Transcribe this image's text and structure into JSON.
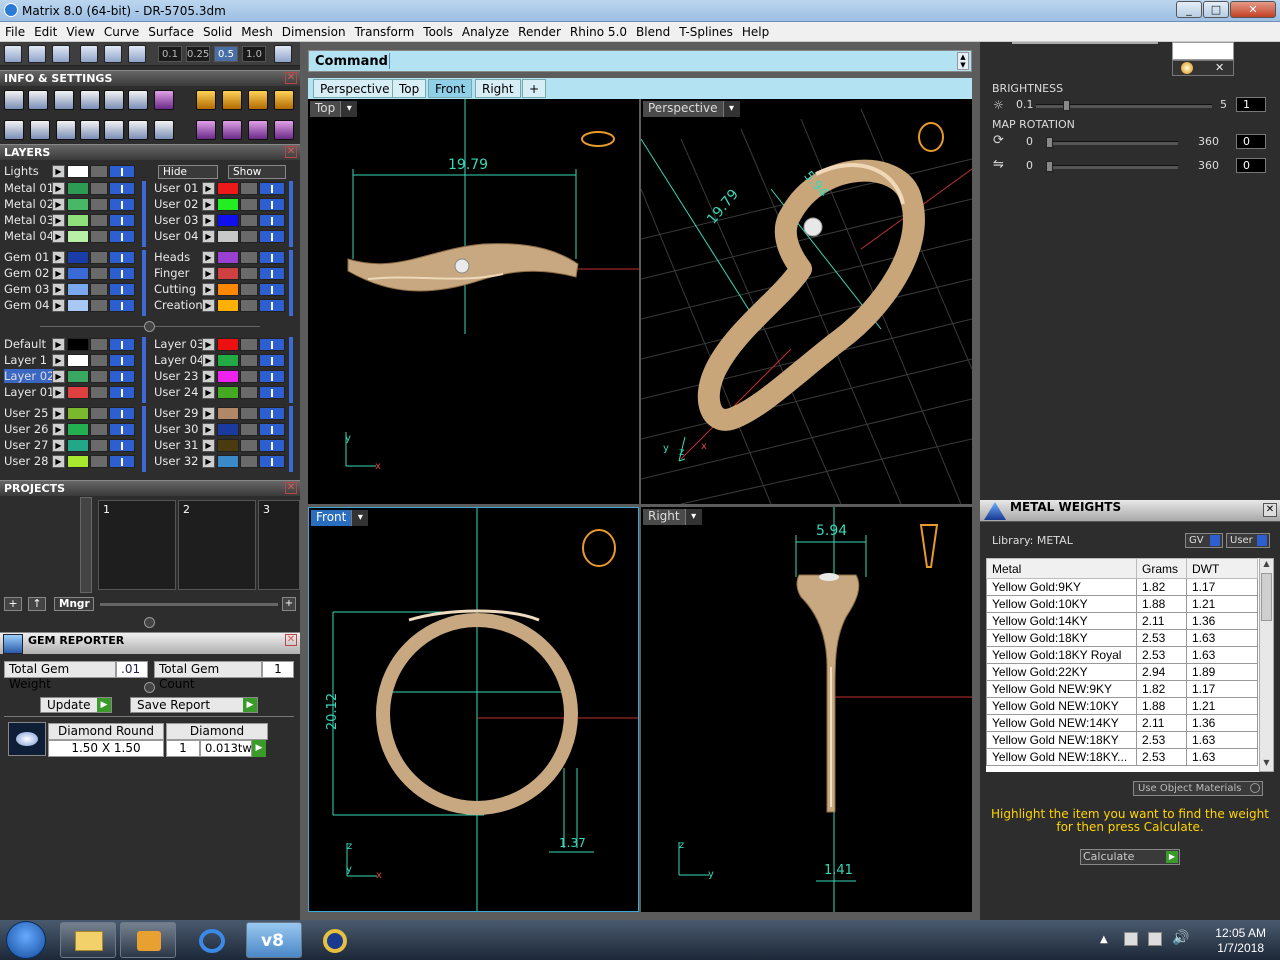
{
  "window": {
    "title": "Matrix 8.0 (64-bit) - DR-5705.3dm",
    "min": "_",
    "max": "□",
    "close": "✕"
  },
  "menu": [
    "File",
    "Edit",
    "View",
    "Curve",
    "Surface",
    "Solid",
    "Mesh",
    "Dimension",
    "Transform",
    "Tools",
    "Analyze",
    "Render",
    "Rhino 5.0",
    "Blend",
    "T-Splines",
    "Help"
  ],
  "toolbar": {
    "num_buttons": [
      "0.1",
      "0.25",
      "0.5",
      "1.0"
    ],
    "active_num": "0.5"
  },
  "panels": {
    "info_settings": "INFO & SETTINGS",
    "layers": "LAYERS",
    "projects": "PROJECTS",
    "gem_reporter": "GEM REPORTER",
    "close_glyph": "✕"
  },
  "layers": {
    "lights": "Lights",
    "hide": "Hide",
    "show": "Show",
    "left": [
      {
        "name": "Metal 01",
        "color": "#2e9b54"
      },
      {
        "name": "Metal 02",
        "color": "#46b866"
      },
      {
        "name": "Metal 03",
        "color": "#8ee07a"
      },
      {
        "name": "Metal 04",
        "color": "#b8f0a8"
      },
      {
        "name": "Gem 01",
        "color": "#1a3ea8"
      },
      {
        "name": "Gem 02",
        "color": "#3a6ad6"
      },
      {
        "name": "Gem 03",
        "color": "#7aa8ee"
      },
      {
        "name": "Gem 04",
        "color": "#a8c8f6"
      },
      {
        "name": "Default",
        "color": "#000000"
      },
      {
        "name": "Layer 1",
        "color": "#ffffff"
      },
      {
        "name": "Layer 02",
        "color": "#3aa860"
      },
      {
        "name": "Layer 01",
        "color": "#e04040"
      },
      {
        "name": "User 25",
        "color": "#7ab82e"
      },
      {
        "name": "User 26",
        "color": "#22b050"
      },
      {
        "name": "User 27",
        "color": "#22a888"
      },
      {
        "name": "User 28",
        "color": "#a8e82e"
      }
    ],
    "right": [
      {
        "name": "User 01",
        "color": "#ee1a1a"
      },
      {
        "name": "User 02",
        "color": "#22ee22"
      },
      {
        "name": "User 03",
        "color": "#1010ee"
      },
      {
        "name": "User 04",
        "color": "#c8c8c8"
      },
      {
        "name": "Heads",
        "color": "#9a40d0"
      },
      {
        "name": "Finger",
        "color": "#d04040"
      },
      {
        "name": "Cutting",
        "color": "#ff8800"
      },
      {
        "name": "Creation",
        "color": "#ffb000"
      },
      {
        "name": "Layer 03",
        "color": "#ee1010"
      },
      {
        "name": "Layer 04",
        "color": "#22aa44"
      },
      {
        "name": "User 23",
        "color": "#ee22ee"
      },
      {
        "name": "User 24",
        "color": "#44aa22"
      },
      {
        "name": "User 29",
        "color": "#b08868"
      },
      {
        "name": "User 30",
        "color": "#1a3aa0"
      },
      {
        "name": "User 31",
        "color": "#4a3a10"
      },
      {
        "name": "User 32",
        "color": "#3a8ac8"
      }
    ],
    "selected": "Layer 02"
  },
  "projects": {
    "slots": [
      "1",
      "2",
      "3"
    ],
    "mngr": "Mngr"
  },
  "gem_reporter": {
    "total_weight_label": "Total Gem Weight",
    "total_weight": ".01",
    "total_count_label": "Total Gem Count",
    "total_count": "1",
    "update": "Update",
    "save_report": "Save Report",
    "gem": {
      "cut": "Diamond Round",
      "size": "1.50 X 1.50",
      "material": "Diamond",
      "count": "1",
      "weight": "0.013tw"
    }
  },
  "command": {
    "label": "Command:",
    "value": ""
  },
  "tabs": [
    "Perspective",
    "Top",
    "Front",
    "Right",
    "+"
  ],
  "active_tab": "Front",
  "viewports": {
    "top": {
      "label": "Top",
      "dim": "19.79"
    },
    "perspective": {
      "label": "Perspective",
      "dim_a": "19.79",
      "dim_b": "5.94"
    },
    "front": {
      "label": "Front",
      "dim_a": "20.12",
      "dim_b": "1.37"
    },
    "right": {
      "label": "Right",
      "dim_a": "5.94",
      "dim_b": "1.41"
    },
    "axis": {
      "x": "x",
      "y": "y",
      "z": "z"
    }
  },
  "render": {
    "brightness_label": "BRIGHTNESS",
    "brightness_min": "0.1",
    "brightness_max": "5",
    "brightness_val": "1",
    "brightness_level": 0.16,
    "map_rotation_label": "MAP ROTATION",
    "rot1_min": "0",
    "rot1_max": "360",
    "rot1_val": "0",
    "rot2_min": "0",
    "rot2_max": "360",
    "rot2_val": "0"
  },
  "metal_weights": {
    "title": "METAL WEIGHTS",
    "library": "Library: METAL",
    "gv": "GV",
    "user": "User",
    "columns": [
      "Metal",
      "Grams",
      "DWT"
    ],
    "rows": [
      [
        "Yellow Gold:9KY",
        "1.82",
        "1.17"
      ],
      [
        "Yellow Gold:10KY",
        "1.88",
        "1.21"
      ],
      [
        "Yellow Gold:14KY",
        "2.11",
        "1.36"
      ],
      [
        "Yellow Gold:18KY",
        "2.53",
        "1.63"
      ],
      [
        "Yellow Gold:18KY Royal",
        "2.53",
        "1.63"
      ],
      [
        "Yellow Gold:22KY",
        "2.94",
        "1.89"
      ],
      [
        "Yellow Gold NEW:9KY",
        "1.82",
        "1.17"
      ],
      [
        "Yellow Gold NEW:10KY",
        "1.88",
        "1.21"
      ],
      [
        "Yellow Gold NEW:14KY",
        "2.11",
        "1.36"
      ],
      [
        "Yellow Gold NEW:18KY",
        "2.53",
        "1.63"
      ],
      [
        "Yellow Gold NEW:18KY...",
        "2.53",
        "1.63"
      ]
    ],
    "use_object_materials": "Use Object Materials",
    "hint": "Highlight the item you want to find the weight for then press Calculate.",
    "calculate": "Calculate"
  },
  "taskbar": {
    "time": "12:05 AM",
    "date": "1/7/2018",
    "v8": "v8"
  },
  "colors": {
    "accent": "#b3e3f3",
    "ring": "#d6b896",
    "dim": "#38d8b8",
    "hint": "#ffd400"
  }
}
